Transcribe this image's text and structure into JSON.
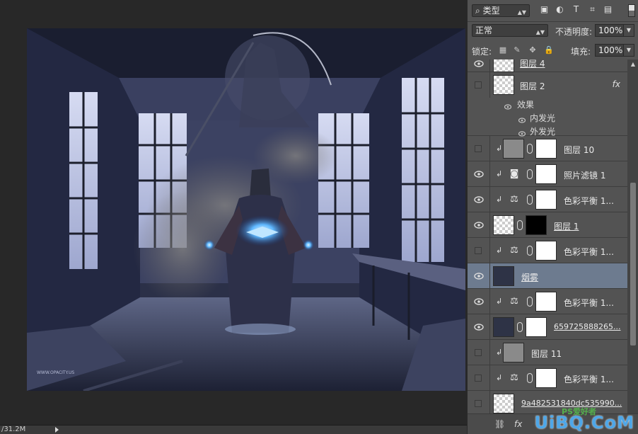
{
  "status": {
    "doc_size": "/31.2M"
  },
  "canvas": {
    "watermark_text": "WWW.OPACITY.US"
  },
  "panel": {
    "filter_kind": "类型",
    "blend_mode": "正常",
    "opacity_label": "不透明度:",
    "opacity_value": "100%",
    "lock_label": "锁定:",
    "fill_label": "填充:",
    "fill_value": "100%"
  },
  "layers": [
    {
      "name": "图层 4",
      "visible": true
    },
    {
      "name": "图层 2",
      "visible": false,
      "fx": "fx",
      "effects_label": "效果",
      "effects": [
        "内发光",
        "外发光"
      ]
    },
    {
      "name": "图层 10",
      "visible": false
    },
    {
      "name": "照片滤镜 1",
      "visible": true
    },
    {
      "name": "色彩平衡 1...",
      "visible": true
    },
    {
      "name": "图层 1",
      "visible": true
    },
    {
      "name": "色彩平衡 1...",
      "visible": false
    },
    {
      "name": "烟雾",
      "visible": true,
      "selected": true
    },
    {
      "name": "色彩平衡 1...",
      "visible": true
    },
    {
      "name": "659725888265...",
      "visible": true
    },
    {
      "name": "图层 11",
      "visible": false
    },
    {
      "name": "色彩平衡 1...",
      "visible": false
    },
    {
      "name": "9a482531840dc535990...",
      "visible": false
    }
  ],
  "footer": {
    "link_icon": "link-icon",
    "fx_label": "fx"
  },
  "site_watermark": {
    "small": "PS爱好者",
    "big": "UiBQ.CoM"
  }
}
